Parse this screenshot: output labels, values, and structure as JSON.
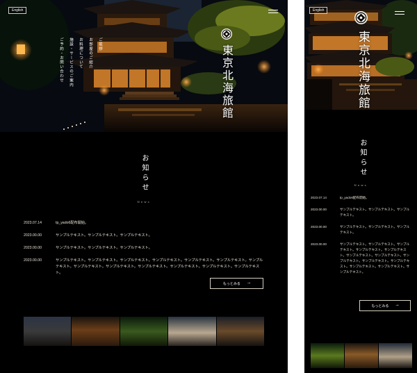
{
  "desktop": {
    "lang_label": "English",
    "nav": [
      "ご挨拶",
      "お部屋のご紹介",
      "お料理について",
      "施設・サービスのご案内",
      "ご予約・お問い合わせ"
    ],
    "brand": "東京北海旅館",
    "news": {
      "title": "お知らせ",
      "subtitle": "News",
      "items": [
        {
          "date": "2023.07.14",
          "text": "tp_yado6配布開始。"
        },
        {
          "date": "2023.00.00",
          "text": "サンプルテキスト。サンプルテキスト。サンプルテキスト。"
        },
        {
          "date": "2023.00.00",
          "text": "サンプルテキスト。サンプルテキスト。サンプルテキスト。"
        },
        {
          "date": "2023.00.00",
          "text": "サンプルテキスト。サンプルテキスト。サンプルテキスト。サンプルテキスト。サンプルテキスト。サンプルテキスト。サンプルテキスト。サンプルテキスト。サンプルテキスト。サンプルテキスト。サンプルテキスト。サンプルテキスト。サンプルテキスト。"
        }
      ],
      "more_label": "もっとみる",
      "more_arrow": "→"
    }
  },
  "mobile": {
    "lang_label": "English",
    "brand": "東京北海旅館",
    "news": {
      "title": "お知らせ",
      "subtitle": "News",
      "items": [
        {
          "date": "2023.07.14",
          "text": "tp_yado6配布開始。"
        },
        {
          "date": "2023.00.00",
          "text": "サンプルテキスト。サンプルテキスト。サンプルテキスト。"
        },
        {
          "date": "2023.00.00",
          "text": "サンプルテキスト。サンプルテキスト。サンプルテキスト。"
        },
        {
          "date": "2023.00.00",
          "text": "サンプルテキスト。サンプルテキスト。サンプルテキスト。サンプルテキスト。サンプルテキスト。サンプルテキスト。サンプルテキスト。サンプルテキスト。サンプルテキスト。サンプルテキスト。サンプルテキスト。サンプルテキスト。サンプルテキスト。"
        }
      ],
      "more_label": "もっとみる",
      "more_arrow": "→"
    }
  },
  "icons": {
    "menu": "hamburger-menu-icon",
    "crest": "family-crest-icon",
    "arrow": "arrow-right-icon"
  },
  "colors": {
    "background": "#000000",
    "text": "#e8e2d6",
    "accent_glow": "#f2a23c"
  }
}
